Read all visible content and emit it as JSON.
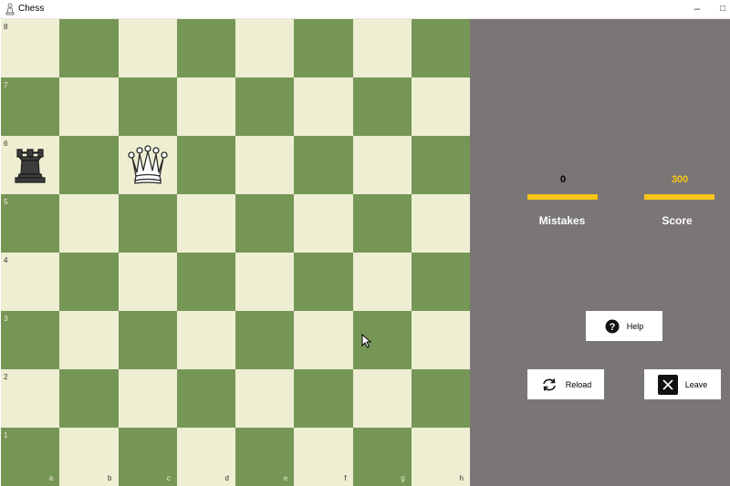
{
  "window": {
    "title": "Chess",
    "minimize_glyph": "–",
    "maximize_glyph": "□"
  },
  "board": {
    "light_color": "#eeeed2",
    "dark_color": "#769656",
    "files": [
      "a",
      "b",
      "c",
      "d",
      "e",
      "f",
      "g",
      "h"
    ],
    "ranks": [
      "8",
      "7",
      "6",
      "5",
      "4",
      "3",
      "2",
      "1"
    ],
    "pieces": [
      {
        "square": "a6",
        "type": "rook",
        "color": "black"
      },
      {
        "square": "c6",
        "type": "queen",
        "color": "white"
      }
    ]
  },
  "stats": {
    "mistakes": {
      "value": "0",
      "label": "Mistakes",
      "value_color": "#ffffff"
    },
    "score": {
      "value": "300",
      "label": "Score",
      "value_color": "#f5c518"
    },
    "bar_color": "#f5c518"
  },
  "buttons": {
    "help": {
      "label": "Help",
      "icon": "question-circle-icon"
    },
    "reload": {
      "label": "Reload",
      "icon": "refresh-arrows-icon"
    },
    "leave": {
      "label": "Leave",
      "icon": "close-x-icon"
    }
  },
  "panel_color": "#7b7676"
}
